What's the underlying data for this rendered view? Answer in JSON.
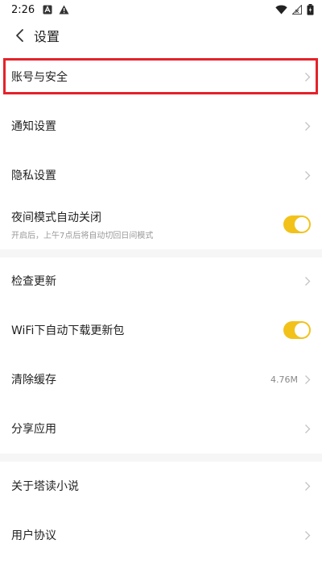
{
  "status_bar": {
    "time": "2:26",
    "left_icons": [
      "a-notification-icon",
      "warning-icon"
    ],
    "right_icons": [
      "wifi-icon",
      "signal-icon",
      "battery-icon"
    ]
  },
  "header": {
    "title": "设置",
    "back_icon": "chevron-left-icon"
  },
  "settings": {
    "account": {
      "label": "账号与安全"
    },
    "notification": {
      "label": "通知设置"
    },
    "privacy": {
      "label": "隐私设置"
    },
    "night_mode": {
      "label": "夜间模式自动关闭",
      "sub": "开启后，上午7点后将自动切回日间模式",
      "toggle_on": true
    },
    "check_update": {
      "label": "检查更新"
    },
    "wifi_download": {
      "label": "WiFi下自动下载更新包",
      "toggle_on": true
    },
    "clear_cache": {
      "label": "清除缓存",
      "value": "4.76M"
    },
    "share_app": {
      "label": "分享应用"
    },
    "about": {
      "label": "关于塔读小说"
    },
    "user_agreement": {
      "label": "用户协议"
    }
  },
  "colors": {
    "accent": "#f2c21b",
    "highlight": "#e5222a",
    "divider": "#f6f6f7"
  }
}
